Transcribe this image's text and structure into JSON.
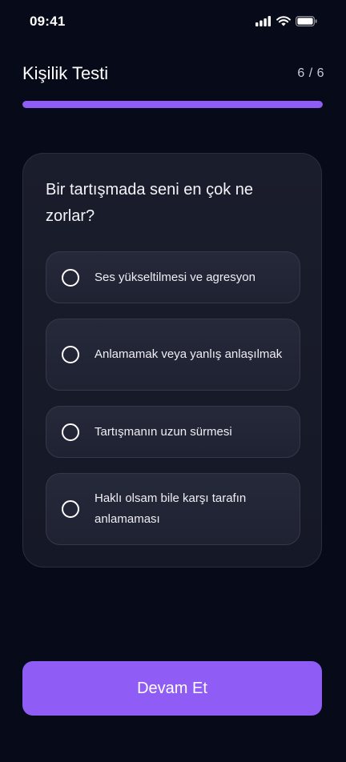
{
  "status_bar": {
    "time": "09:41"
  },
  "header": {
    "title": "Kişilik Testi",
    "counter": "6 / 6"
  },
  "progress": {
    "fraction": 1.0,
    "color": "#8f5cf6"
  },
  "question": {
    "text": "Bir tartışmada seni en çok ne zorlar?",
    "options": [
      {
        "label": "Ses yükseltilmesi ve agresyon"
      },
      {
        "label": "Anlamamak veya yanlış anlaşılmak"
      },
      {
        "label": "Tartışmanın uzun sürmesi"
      },
      {
        "label": "Haklı olsam bile karşı tarafın anlamaması"
      }
    ]
  },
  "footer": {
    "continue_label": "Devam Et"
  },
  "colors": {
    "background": "#070a18",
    "accent": "#8f5cf6",
    "card": "#1a1d2c"
  }
}
